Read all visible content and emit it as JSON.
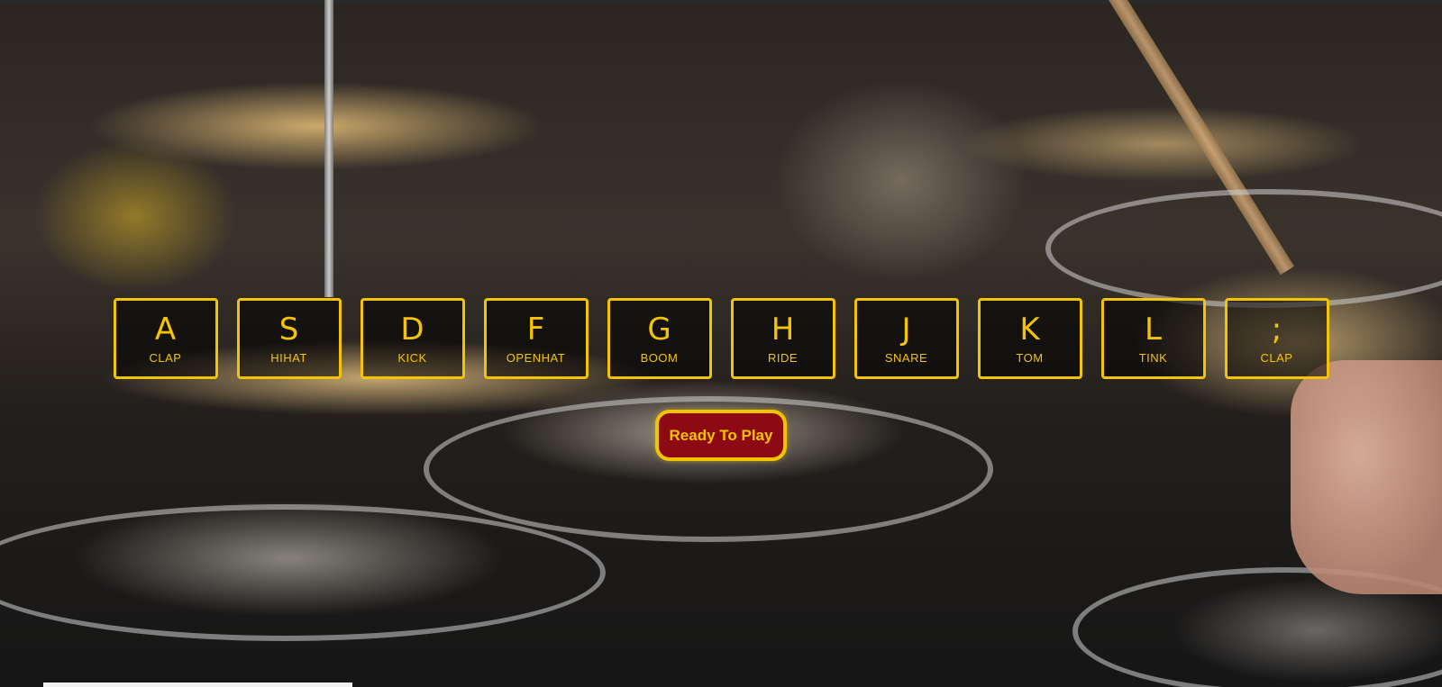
{
  "keys": [
    {
      "key": "A",
      "sound": "clap"
    },
    {
      "key": "S",
      "sound": "hihat"
    },
    {
      "key": "D",
      "sound": "kick"
    },
    {
      "key": "F",
      "sound": "openhat"
    },
    {
      "key": "G",
      "sound": "boom"
    },
    {
      "key": "H",
      "sound": "ride"
    },
    {
      "key": "J",
      "sound": "snare"
    },
    {
      "key": "K",
      "sound": "tom"
    },
    {
      "key": "L",
      "sound": "tink"
    },
    {
      "key": ";",
      "sound": "clap"
    }
  ],
  "ready_button": {
    "label": "Ready To Play"
  },
  "colors": {
    "accent": "#f5c400",
    "button_bg": "#8e0a12"
  }
}
